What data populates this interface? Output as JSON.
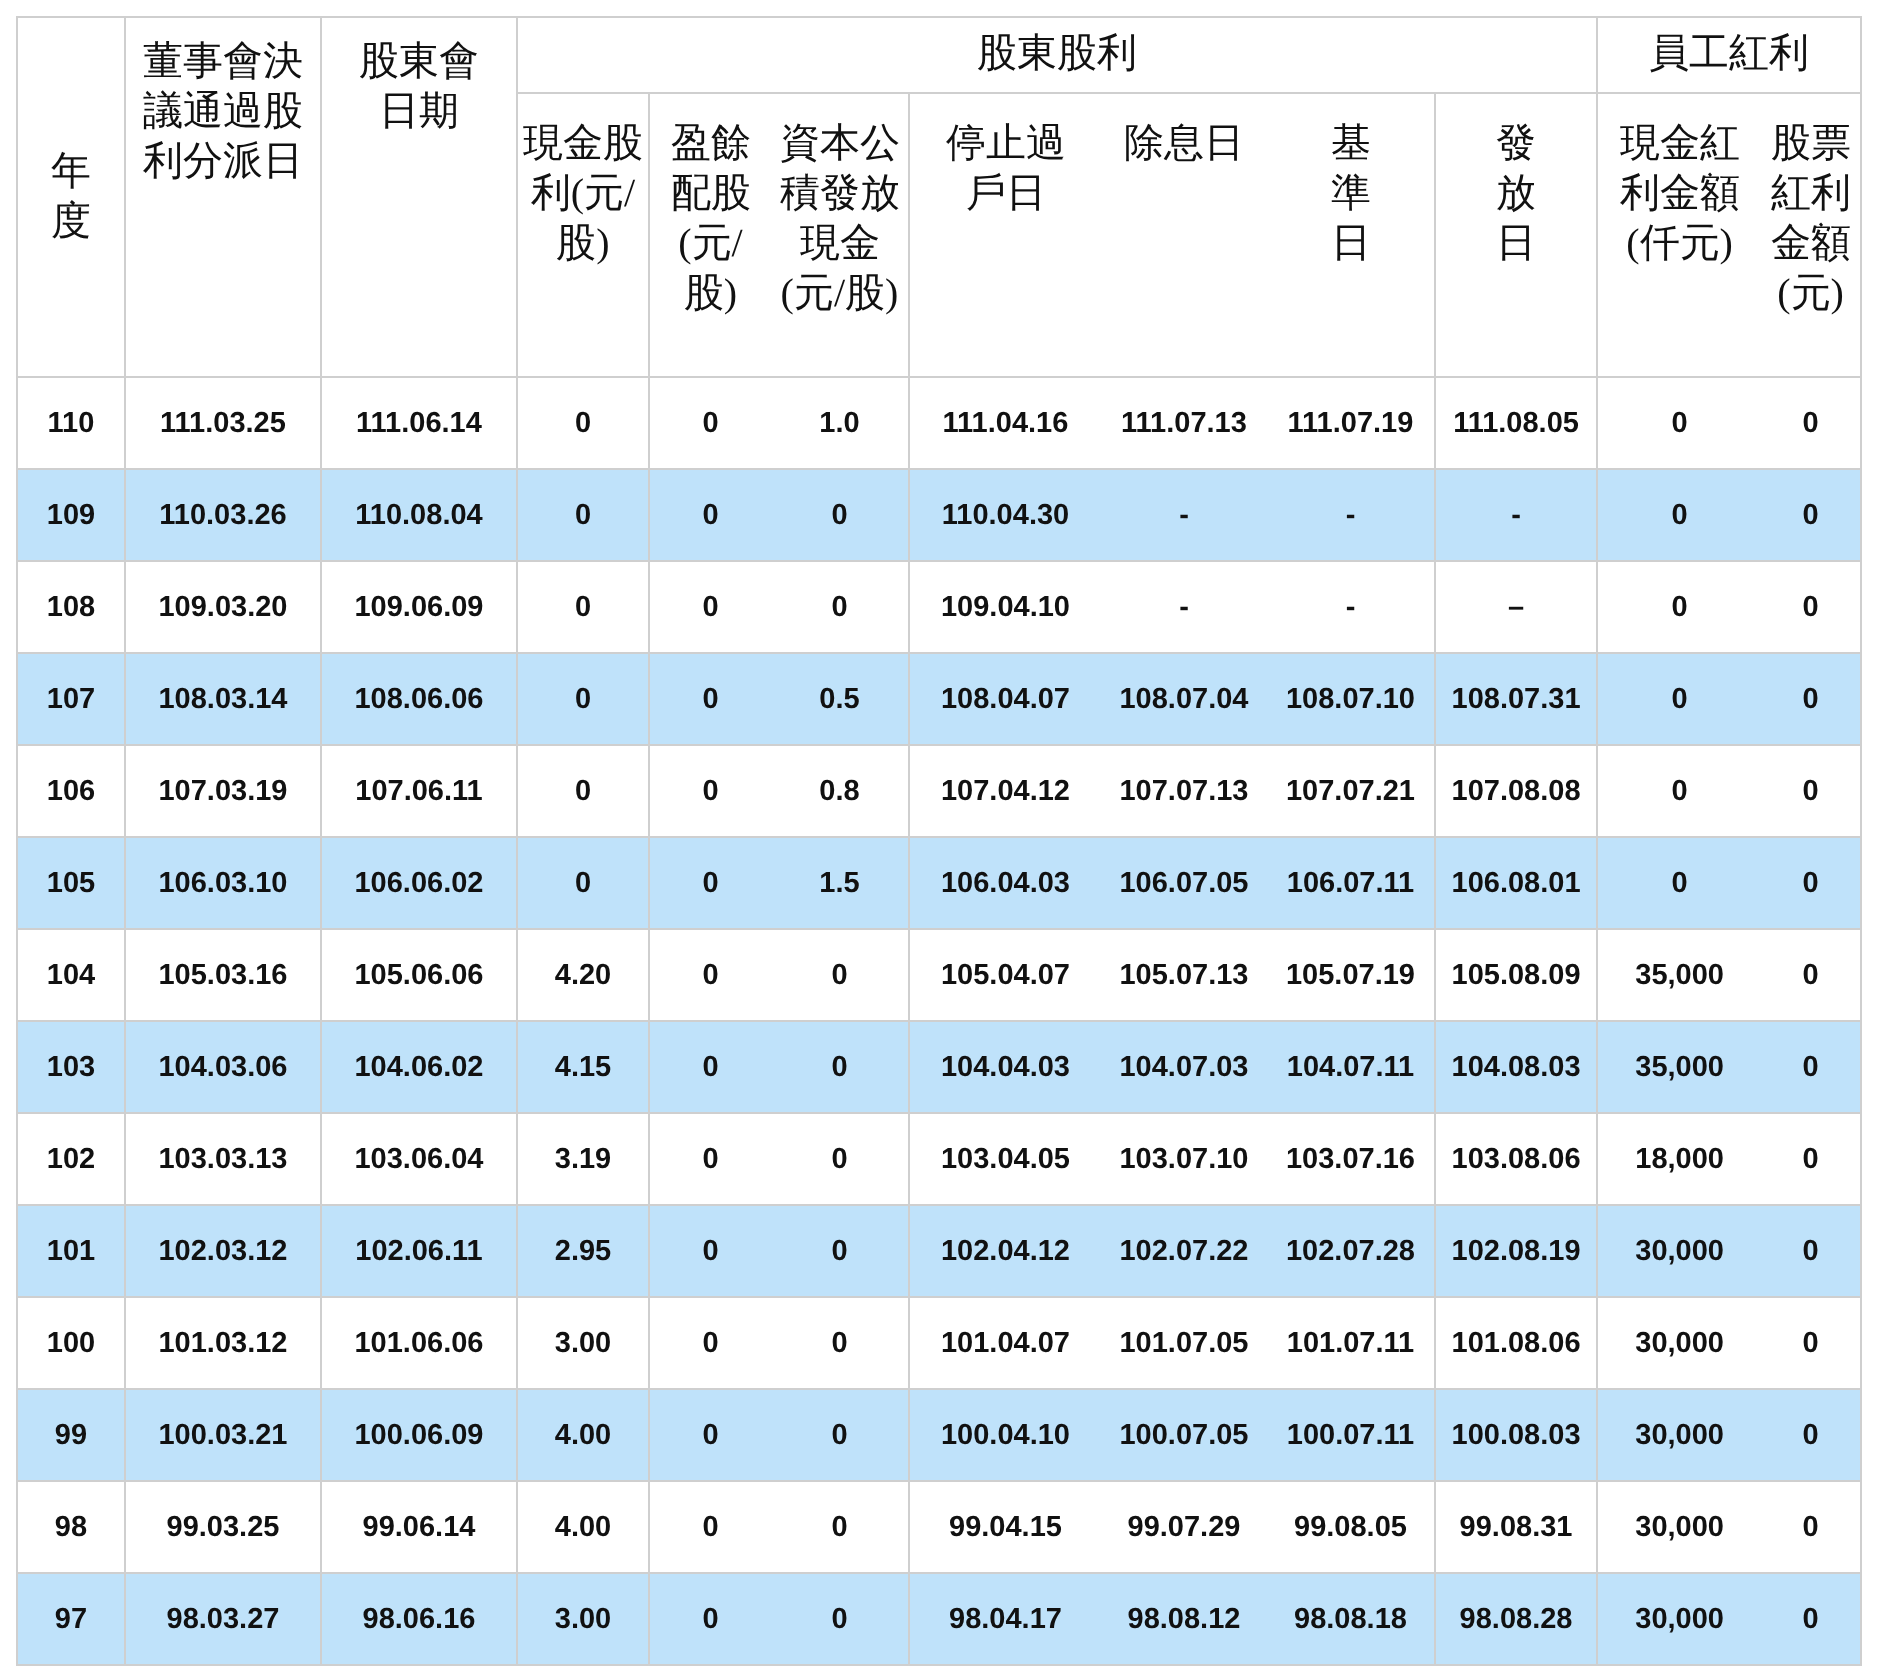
{
  "table": {
    "header": [
      {
        "label": "年度"
      },
      {
        "label": "董事會決議通過股利分派日"
      },
      {
        "label": "股東會日期"
      },
      {
        "group": "股東股利",
        "columns": [
          "現金股利(元/股)",
          "盈餘配股(元/股)",
          "資本公積發放現金(元/股)",
          "停止過戶日",
          "除息日",
          "基準日",
          "發放日"
        ]
      },
      {
        "group": "員工紅利",
        "columns": [
          "現金紅利金額(仟元)",
          "股票紅利金額(元)"
        ]
      }
    ],
    "rows": [
      {
        "shaded": false,
        "cells": [
          "110",
          "111.03.25",
          "111.06.14",
          "0",
          "0",
          "1.0",
          "111.04.16",
          "111.07.13",
          "111.07.19",
          "111.08.05",
          "0",
          "0"
        ]
      },
      {
        "shaded": true,
        "cells": [
          "109",
          "110.03.26",
          "110.08.04",
          "0",
          "0",
          "0",
          "110.04.30",
          "-",
          "-",
          "-",
          "0",
          "0"
        ]
      },
      {
        "shaded": false,
        "cells": [
          "108",
          "109.03.20",
          "109.06.09",
          "0",
          "0",
          "0",
          "109.04.10",
          "-",
          "-",
          "–",
          "0",
          "0"
        ]
      },
      {
        "shaded": true,
        "cells": [
          "107",
          "108.03.14",
          "108.06.06",
          "0",
          "0",
          "0.5",
          "108.04.07",
          "108.07.04",
          "108.07.10",
          "108.07.31",
          "0",
          "0"
        ]
      },
      {
        "shaded": false,
        "cells": [
          "106",
          "107.03.19",
          "107.06.11",
          "0",
          "0",
          "0.8",
          "107.04.12",
          "107.07.13",
          "107.07.21",
          "107.08.08",
          "0",
          "0"
        ]
      },
      {
        "shaded": true,
        "cells": [
          "105",
          "106.03.10",
          "106.06.02",
          "0",
          "0",
          "1.5",
          "106.04.03",
          "106.07.05",
          "106.07.11",
          "106.08.01",
          "0",
          "0"
        ]
      },
      {
        "shaded": false,
        "cells": [
          "104",
          "105.03.16",
          "105.06.06",
          "4.20",
          "0",
          "0",
          "105.04.07",
          "105.07.13",
          "105.07.19",
          "105.08.09",
          "35,000",
          "0"
        ]
      },
      {
        "shaded": true,
        "cells": [
          "103",
          "104.03.06",
          "104.06.02",
          "4.15",
          "0",
          "0",
          "104.04.03",
          "104.07.03",
          "104.07.11",
          "104.08.03",
          "35,000",
          "0"
        ]
      },
      {
        "shaded": false,
        "cells": [
          "102",
          "103.03.13",
          "103.06.04",
          "3.19",
          "0",
          "0",
          "103.04.05",
          "103.07.10",
          "103.07.16",
          "103.08.06",
          "18,000",
          "0"
        ]
      },
      {
        "shaded": true,
        "cells": [
          "101",
          "102.03.12",
          "102.06.11",
          "2.95",
          "0",
          "0",
          "102.04.12",
          "102.07.22",
          "102.07.28",
          "102.08.19",
          "30,000",
          "0"
        ]
      },
      {
        "shaded": false,
        "cells": [
          "100",
          "101.03.12",
          "101.06.06",
          "3.00",
          "0",
          "0",
          "101.04.07",
          "101.07.05",
          "101.07.11",
          "101.08.06",
          "30,000",
          "0"
        ]
      },
      {
        "shaded": true,
        "cells": [
          "99",
          "100.03.21",
          "100.06.09",
          "4.00",
          "0",
          "0",
          "100.04.10",
          "100.07.05",
          "100.07.11",
          "100.08.03",
          "30,000",
          "0"
        ]
      },
      {
        "shaded": false,
        "cells": [
          "98",
          "99.03.25",
          "99.06.14",
          "4.00",
          "0",
          "0",
          "99.04.15",
          "99.07.29",
          "99.08.05",
          "99.08.31",
          "30,000",
          "0"
        ]
      },
      {
        "shaded": true,
        "cells": [
          "97",
          "98.03.27",
          "98.06.16",
          "3.00",
          "0",
          "0",
          "98.04.17",
          "98.08.12",
          "98.08.18",
          "98.08.28",
          "30,000",
          "0"
        ]
      }
    ]
  }
}
